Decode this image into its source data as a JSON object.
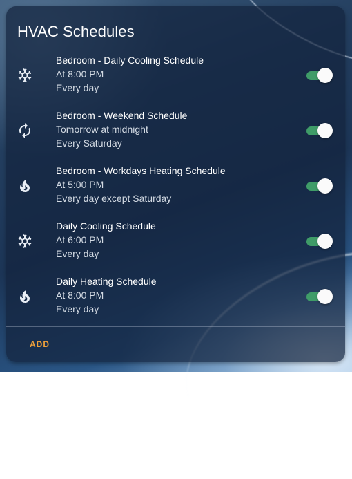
{
  "card": {
    "title": "HVAC Schedules"
  },
  "schedules": [
    {
      "name": "Bedroom - Daily Cooling Schedule",
      "when": "At 8:00 PM",
      "repeat": "Every day",
      "icon": "snowflake-icon",
      "enabled": true
    },
    {
      "name": "Bedroom - Weekend Schedule",
      "when": "Tomorrow at midnight",
      "repeat": "Every Saturday",
      "icon": "autorenew-icon",
      "enabled": true
    },
    {
      "name": "Bedroom - Workdays Heating Schedule",
      "when": "At 5:00 PM",
      "repeat": "Every day except Saturday",
      "icon": "fire-icon",
      "enabled": true
    },
    {
      "name": "Daily Cooling Schedule",
      "when": "At 6:00 PM",
      "repeat": "Every day",
      "icon": "snowflake-icon",
      "enabled": true
    },
    {
      "name": "Daily Heating Schedule",
      "when": "At 8:00 PM",
      "repeat": "Every day",
      "icon": "fire-icon",
      "enabled": true
    }
  ],
  "actions": {
    "add_label": "ADD"
  },
  "colors": {
    "toggle_on": "#3f9c68",
    "accent": "#f0a13a"
  }
}
